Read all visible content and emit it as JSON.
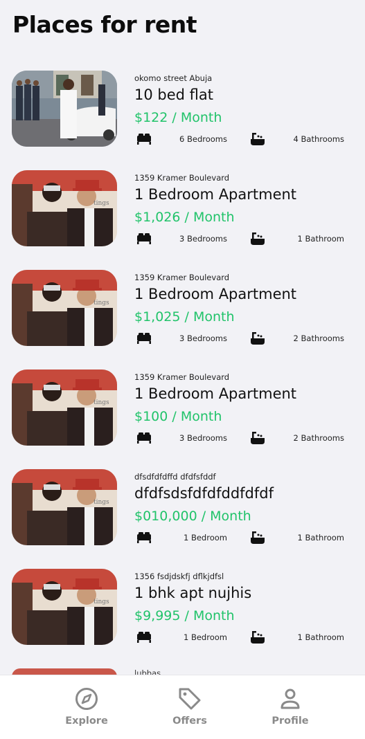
{
  "page_title": "Places for rent",
  "colors": {
    "accent_green": "#21c36a",
    "tab_inactive": "#8a8a8a",
    "background": "#f2f2f6"
  },
  "listings": [
    {
      "address": "okomo street Abuja",
      "title": "10 bed flat",
      "price": "$122 / Month",
      "bedrooms": "6 Bedrooms",
      "bathrooms": "4 Bathrooms",
      "photo": "white-car-group-photo"
    },
    {
      "address": "1359 Kramer Boulevard",
      "title": "1 Bedroom Apartment",
      "price": "$1,026 / Month",
      "bedrooms": "3 Bedrooms",
      "bathrooms": "1 Bathroom",
      "photo": "two-men-photo"
    },
    {
      "address": "1359 Kramer Boulevard",
      "title": "1 Bedroom Apartment",
      "price": "$1,025 / Month",
      "bedrooms": "3 Bedrooms",
      "bathrooms": "2 Bathrooms",
      "photo": "two-men-photo"
    },
    {
      "address": "1359 Kramer Boulevard",
      "title": "1 Bedroom Apartment",
      "price": "$100 / Month",
      "bedrooms": "3 Bedrooms",
      "bathrooms": "2 Bathrooms",
      "photo": "two-men-photo"
    },
    {
      "address": "dfsdfdfdffd dfdfsfddf",
      "title": "dfdfsdsfdfdfddfdfdf",
      "price": "$010,000 / Month",
      "bedrooms": "1 Bedroom",
      "bathrooms": "1 Bathroom",
      "photo": "two-men-photo"
    },
    {
      "address": "1356 fsdjdskfj dflkjdfsl",
      "title": "1 bhk apt nujhis",
      "price": "$9,995 / Month",
      "bedrooms": "1 Bedroom",
      "bathrooms": "1 Bathroom",
      "photo": "two-men-photo"
    }
  ],
  "peek_address": "lubbas",
  "tabs": [
    {
      "label": "Explore",
      "icon": "compass-icon"
    },
    {
      "label": "Offers",
      "icon": "tag-icon"
    },
    {
      "label": "Profile",
      "icon": "person-icon"
    }
  ]
}
